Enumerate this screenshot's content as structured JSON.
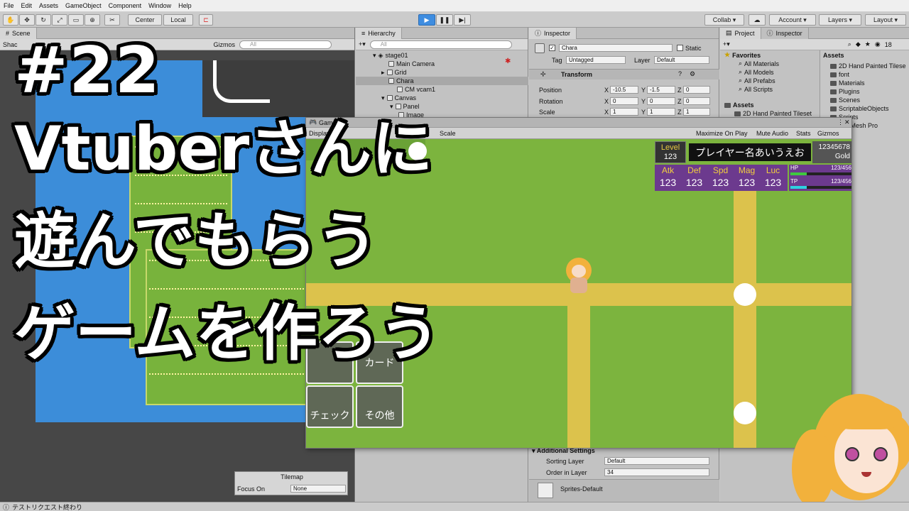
{
  "menubar": {
    "items": [
      "File",
      "Edit",
      "Assets",
      "GameObject",
      "Component",
      "Window",
      "Help"
    ]
  },
  "toolbar": {
    "center_label": "Center",
    "local_label": "Local",
    "collab_label": "Collab",
    "account_label": "Account",
    "layers_label": "Layers",
    "layout_label": "Layout"
  },
  "scene": {
    "tab_label": "Scene",
    "shading_label": "Shac",
    "gizmos_label": "Gizmos",
    "search_placeholder": "All"
  },
  "hierarchy": {
    "tab_label": "Hierarchy",
    "search_placeholder": "All",
    "items": [
      "stage01",
      "Main Camera",
      "Grid",
      "Chara",
      "CM vcam1",
      "Canvas",
      "Panel",
      "Image"
    ]
  },
  "inspector": {
    "tab_label": "Inspector",
    "object_name": "Chara",
    "static_label": "Static",
    "tag_label": "Tag",
    "tag_value": "Untagged",
    "layer_label": "Layer",
    "layer_value": "Default",
    "transform_label": "Transform",
    "position_label": "Position",
    "rotation_label": "Rotation",
    "scale_label": "Scale",
    "pos": {
      "x": "-10.5",
      "y": "-1.5",
      "z": "0"
    },
    "rot": {
      "x": "0",
      "y": "0",
      "z": "0"
    },
    "scl": {
      "x": "1",
      "y": "1",
      "z": "1"
    },
    "axis_x": "X",
    "axis_y": "Y",
    "axis_z": "Z",
    "additional_settings": "Additional Settings",
    "sorting_layer_label": "Sorting Layer",
    "sorting_layer_value": "Default",
    "order_label": "Order in Layer",
    "order_value": "34",
    "material_label": "Sprites-Default"
  },
  "project": {
    "tab_label": "Project",
    "tab2_label": "Inspector",
    "favorites_label": "Favorites",
    "favorites": [
      "All Materials",
      "All Models",
      "All Prefabs",
      "All Scripts"
    ],
    "assets_label": "Assets",
    "assets_tree": [
      "2D Hand Painted Tileset"
    ],
    "assets_header": "Assets",
    "asset_folders": [
      "2D Hand Painted Tilese",
      "font",
      "Materials",
      "Plugins",
      "Scenes",
      "ScriptableObjects",
      "Scripts",
      "TextMesh Pro"
    ],
    "count_badge": "18"
  },
  "game": {
    "tab_label": "Game",
    "display_label": "Display 1",
    "scale_label": "Scale",
    "maximize_label": "Maximize On Play",
    "mute_label": "Mute Audio",
    "stats_label": "Stats",
    "gizmos_label": "Gizmos",
    "hud": {
      "level_label": "Level",
      "level_value": "123",
      "player_name": "プレイヤー名あいうえお",
      "gold_value": "12345678",
      "gold_label": "Gold",
      "stats": [
        {
          "label": "Atk",
          "value": "123"
        },
        {
          "label": "Def",
          "value": "123"
        },
        {
          "label": "Spd",
          "value": "123"
        },
        {
          "label": "Mag",
          "value": "123"
        },
        {
          "label": "Luc",
          "value": "123"
        }
      ],
      "hp_label": "HP",
      "hp_value": "123/456",
      "hp_fill": 0.27,
      "tp_label": "TP",
      "tp_value": "123/456",
      "tp_fill": 0.27
    },
    "buttons": {
      "card": "カード",
      "check": "チェック",
      "other": "その他"
    }
  },
  "title": {
    "line1": "#22",
    "line2": "Vtuberさんに",
    "line3": "遊んでもらう",
    "line4": "ゲームを作ろう"
  },
  "tilemap": {
    "title": "Tilemap",
    "focus_label": "Focus On",
    "focus_value": "None"
  },
  "statusbar": {
    "message": "テストリクエスト終わり"
  },
  "colors": {
    "play_blue": "#3f8de0",
    "grass": "#7cb43e",
    "road": "#dcc24c",
    "hud_purple": "#6c3a8e",
    "gold_text": "#e6c842"
  }
}
